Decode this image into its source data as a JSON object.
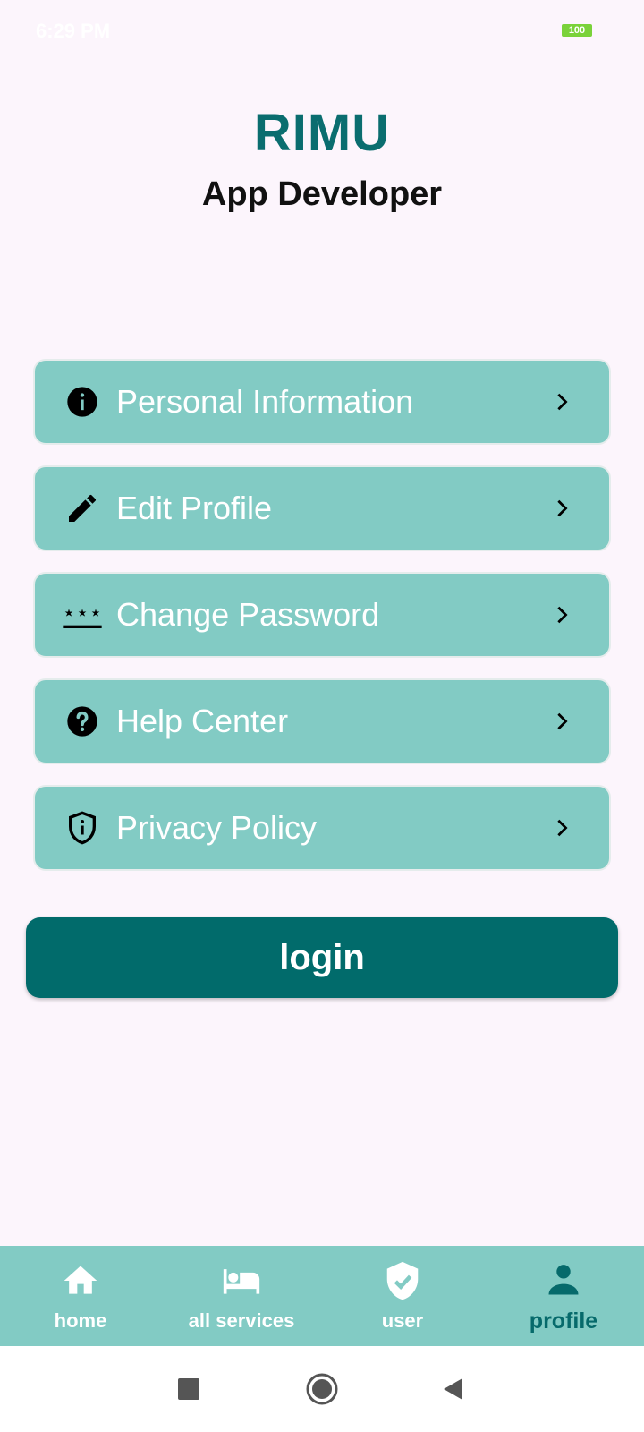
{
  "status": {
    "time": "6:29 PM",
    "battery": "100"
  },
  "profile": {
    "name": "RIMU",
    "role": "App Developer"
  },
  "menu": [
    {
      "label": "Personal Information",
      "icon": "info-icon"
    },
    {
      "label": "Edit Profile",
      "icon": "pencil-icon"
    },
    {
      "label": "Change Password",
      "icon": "password-icon"
    },
    {
      "label": "Help Center",
      "icon": "help-icon"
    },
    {
      "label": "Privacy Policy",
      "icon": "shield-info-icon"
    }
  ],
  "login_button": {
    "label": "login"
  },
  "bottom_nav": [
    {
      "label": "home",
      "icon": "home-icon",
      "active": false
    },
    {
      "label": "all services",
      "icon": "bed-icon",
      "active": false
    },
    {
      "label": "user",
      "icon": "verified-shield-icon",
      "active": false
    },
    {
      "label": "profile",
      "icon": "person-icon",
      "active": true
    }
  ],
  "colors": {
    "primary": "#016b6b",
    "accent": "#82cbc4",
    "background": "#fcf5fc"
  }
}
